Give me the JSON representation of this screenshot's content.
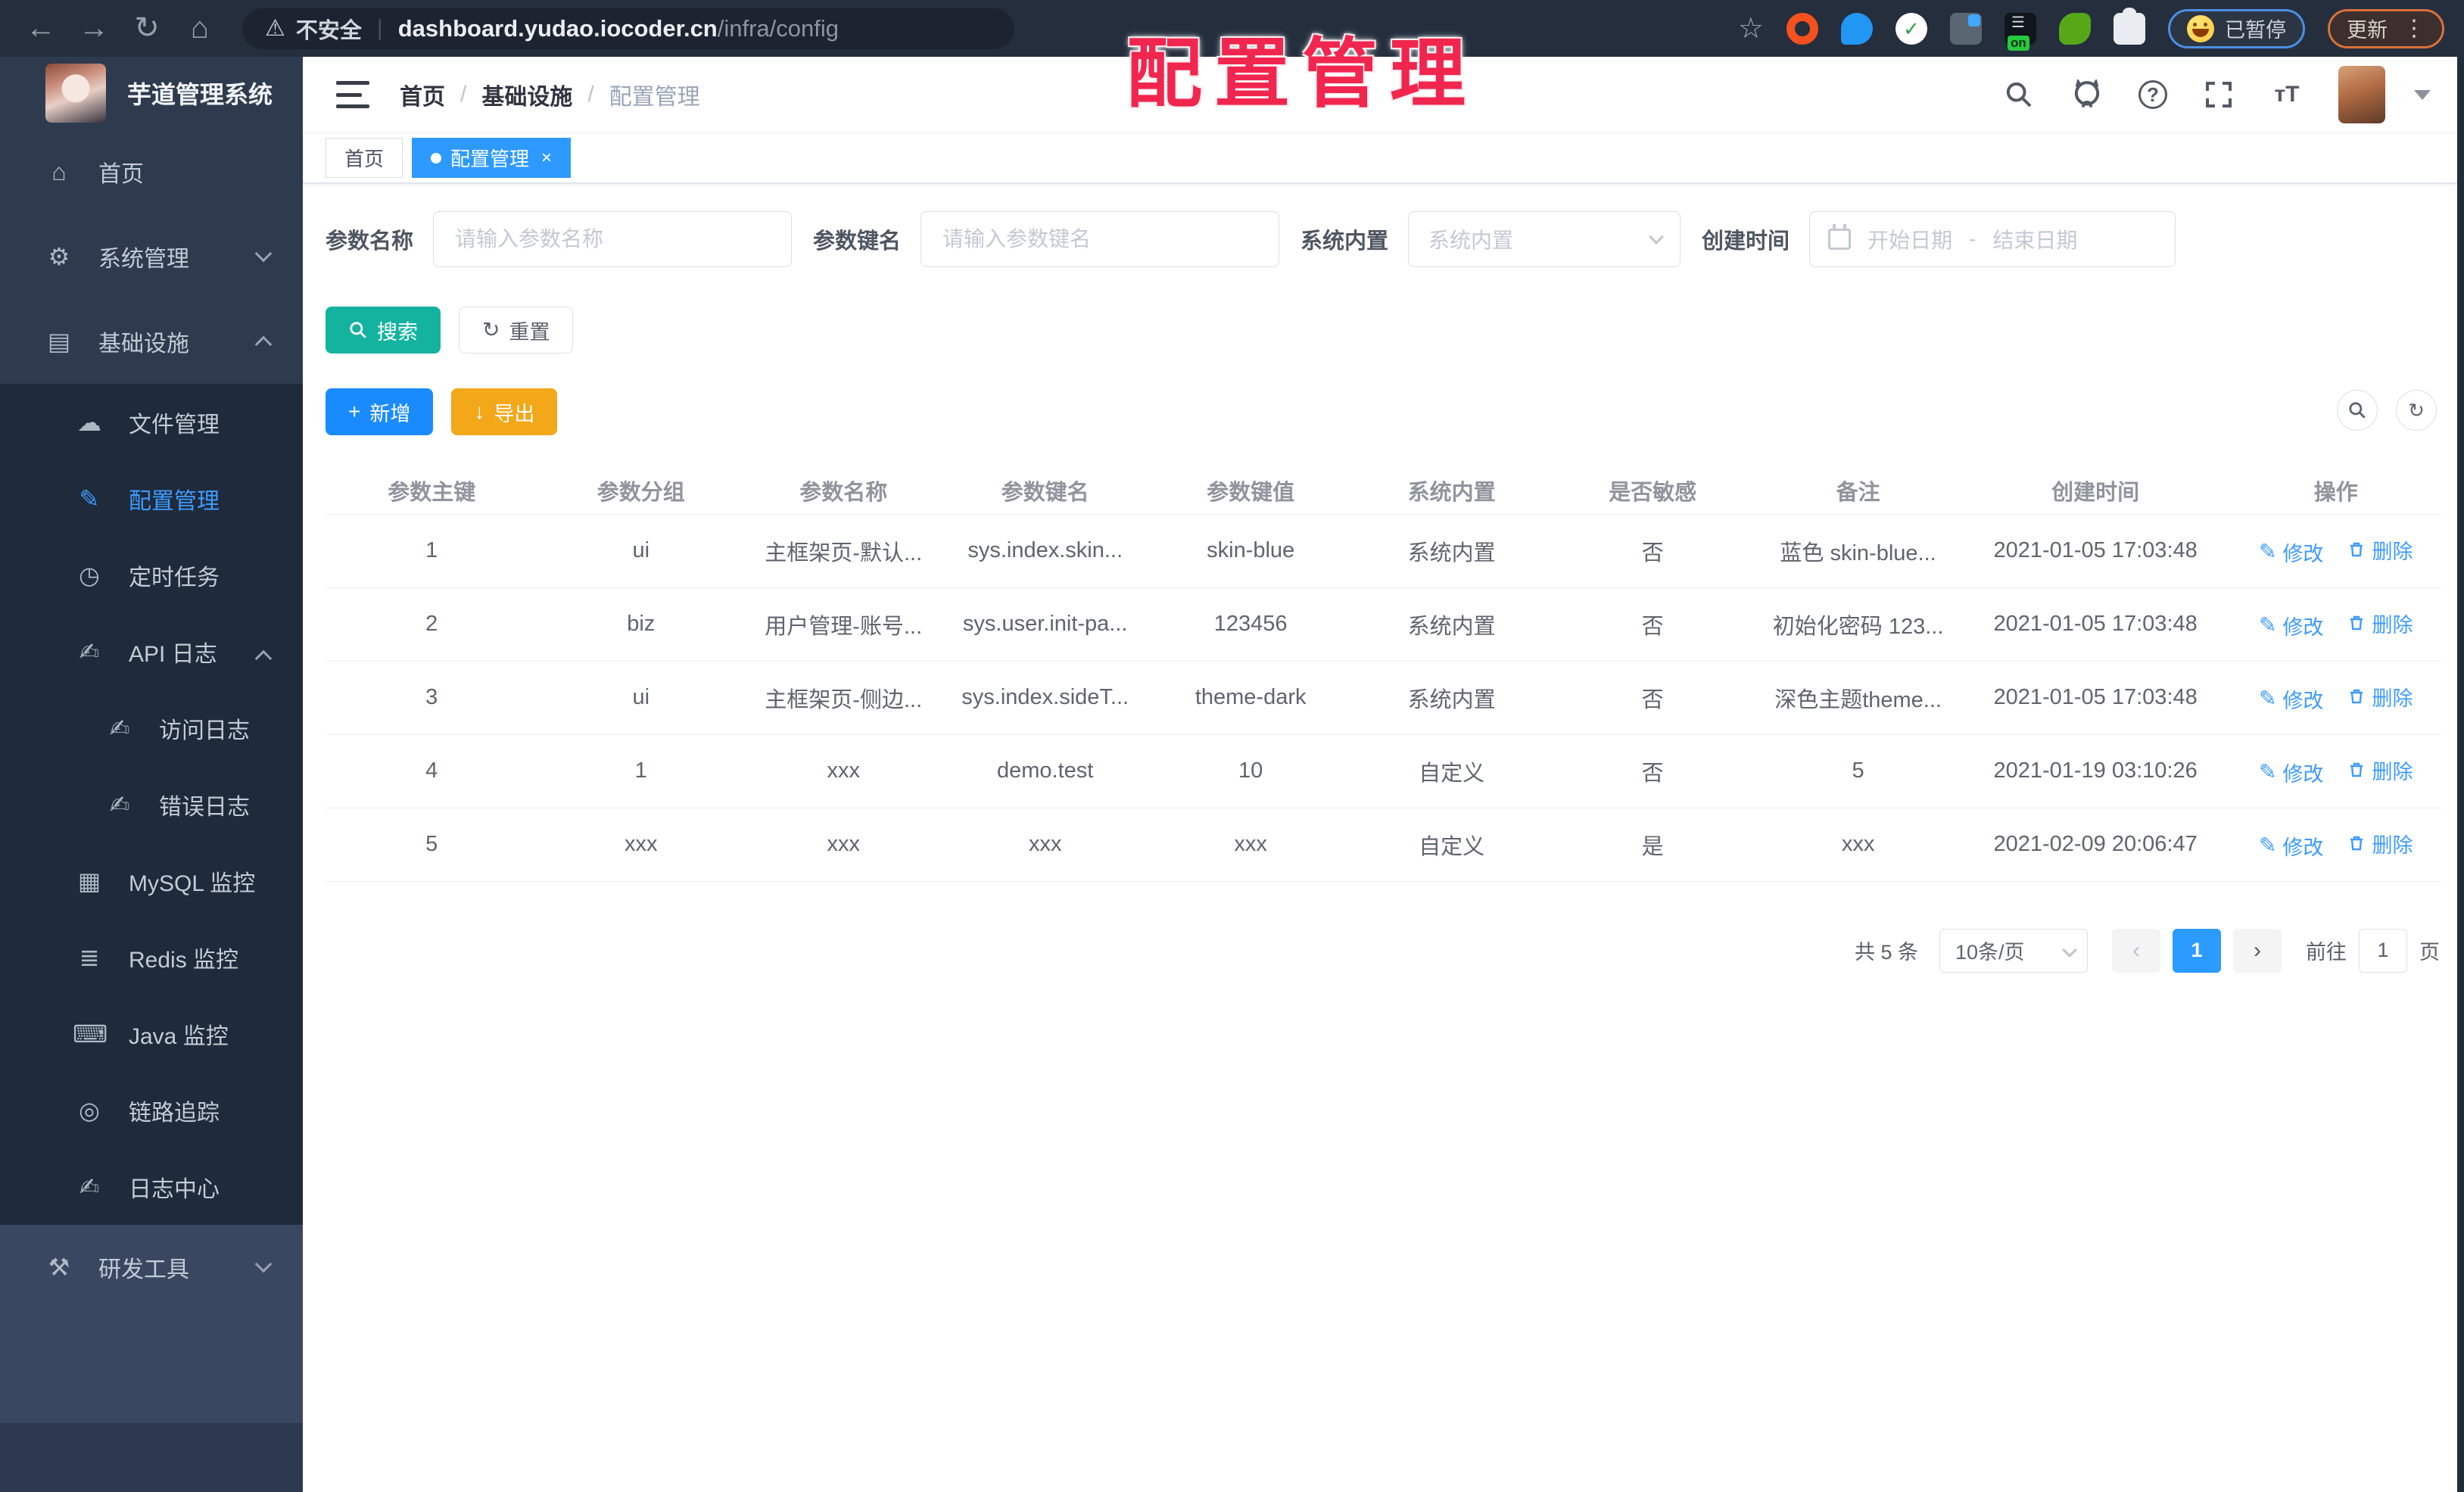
{
  "browser": {
    "security_label": "不安全",
    "url_domain": "dashboard.yudao.iocoder.cn",
    "url_path": "/infra/config",
    "paused_badge": "已暂停",
    "update_button": "更新",
    "nav_icons": [
      "back-icon",
      "forward-icon",
      "reload-icon",
      "home-icon"
    ],
    "right_icons": [
      "bookmark-star-icon",
      "extension-ring-icon",
      "extension-pin-icon",
      "extension-check-icon",
      "extension-grid-icon",
      "extension-on-icon",
      "extension-leaf-icon",
      "extension-puzzle-icon",
      "more-menu-icon"
    ]
  },
  "watermark": "配置管理",
  "sidebar": {
    "logo_title": "芋道管理系统",
    "items": [
      {
        "label": "首页",
        "icon": "home-icon",
        "level": 1
      },
      {
        "label": "系统管理",
        "icon": "gear-icon",
        "level": 1,
        "chevron": "down"
      },
      {
        "label": "基础设施",
        "icon": "infra-icon",
        "level": 1,
        "chevron": "up"
      },
      {
        "label": "文件管理",
        "icon": "cloud-icon",
        "level": 2
      },
      {
        "label": "配置管理",
        "icon": "edit-icon",
        "level": 2,
        "active": true
      },
      {
        "label": "定时任务",
        "icon": "clock-icon",
        "level": 2
      },
      {
        "label": "API 日志",
        "icon": "log-icon",
        "level": 2,
        "chevron": "up"
      },
      {
        "label": "访问日志",
        "icon": "log-icon",
        "level": 3
      },
      {
        "label": "错误日志",
        "icon": "log-icon",
        "level": 3
      },
      {
        "label": "MySQL 监控",
        "icon": "database-icon",
        "level": 2
      },
      {
        "label": "Redis 监控",
        "icon": "redis-icon",
        "level": 2
      },
      {
        "label": "Java 监控",
        "icon": "java-icon",
        "level": 2
      },
      {
        "label": "链路追踪",
        "icon": "eye-icon",
        "level": 2
      },
      {
        "label": "日志中心",
        "icon": "log-icon",
        "level": 2
      },
      {
        "label": "研发工具",
        "icon": "tools-icon",
        "level": 1,
        "chevron": "down"
      }
    ]
  },
  "header": {
    "breadcrumb": [
      "首页",
      "基础设施",
      "配置管理"
    ],
    "separator": "/",
    "tool_icons": [
      "search-icon",
      "github-icon",
      "help-icon",
      "fullscreen-icon",
      "font-size-icon",
      "avatar",
      "caret-down-icon"
    ]
  },
  "tabs": [
    {
      "label": "首页",
      "active": false
    },
    {
      "label": "配置管理",
      "active": true,
      "closable": true
    }
  ],
  "filters": {
    "name_label": "参数名称",
    "name_placeholder": "请输入参数名称",
    "key_label": "参数键名",
    "key_placeholder": "请输入参数键名",
    "type_label": "系统内置",
    "type_placeholder": "系统内置",
    "date_label": "创建时间",
    "date_start_placeholder": "开始日期",
    "date_separator": "-",
    "date_end_placeholder": "结束日期"
  },
  "actions": {
    "search": "搜索",
    "reset": "重置",
    "add": "新增",
    "export": "导出"
  },
  "table": {
    "columns": [
      "参数主键",
      "参数分组",
      "参数名称",
      "参数键名",
      "参数键值",
      "系统内置",
      "是否敏感",
      "备注",
      "创建时间",
      "操作"
    ],
    "edit_label": "修改",
    "delete_label": "删除",
    "rows": [
      {
        "id": "1",
        "group": "ui",
        "name": "主框架页-默认...",
        "key": "sys.index.skin...",
        "value": "skin-blue",
        "type": "系统内置",
        "sensitive": "否",
        "remark": "蓝色 skin-blue...",
        "created": "2021-01-05 17:03:48"
      },
      {
        "id": "2",
        "group": "biz",
        "name": "用户管理-账号...",
        "key": "sys.user.init-pa...",
        "value": "123456",
        "type": "系统内置",
        "sensitive": "否",
        "remark": "初始化密码 123...",
        "created": "2021-01-05 17:03:48"
      },
      {
        "id": "3",
        "group": "ui",
        "name": "主框架页-侧边...",
        "key": "sys.index.sideT...",
        "value": "theme-dark",
        "type": "系统内置",
        "sensitive": "否",
        "remark": "深色主题theme...",
        "created": "2021-01-05 17:03:48"
      },
      {
        "id": "4",
        "group": "1",
        "name": "xxx",
        "key": "demo.test",
        "value": "10",
        "type": "自定义",
        "sensitive": "否",
        "remark": "5",
        "created": "2021-01-19 03:10:26"
      },
      {
        "id": "5",
        "group": "xxx",
        "name": "xxx",
        "key": "xxx",
        "value": "xxx",
        "type": "自定义",
        "sensitive": "是",
        "remark": "xxx",
        "created": "2021-02-09 20:06:47"
      }
    ]
  },
  "pagination": {
    "total": "共 5 条",
    "page_size": "10条/页",
    "current_page": "1",
    "goto_label": "前往",
    "goto_value": "1",
    "page_suffix": "页"
  },
  "colors": {
    "accent_blue": "#409eff",
    "teal": "#14b3a0",
    "amber": "#f2a819",
    "watermark_red": "#f1264f",
    "sidebar_bg": "#2e3b4e",
    "submenu_bg": "#1f2a3a"
  }
}
